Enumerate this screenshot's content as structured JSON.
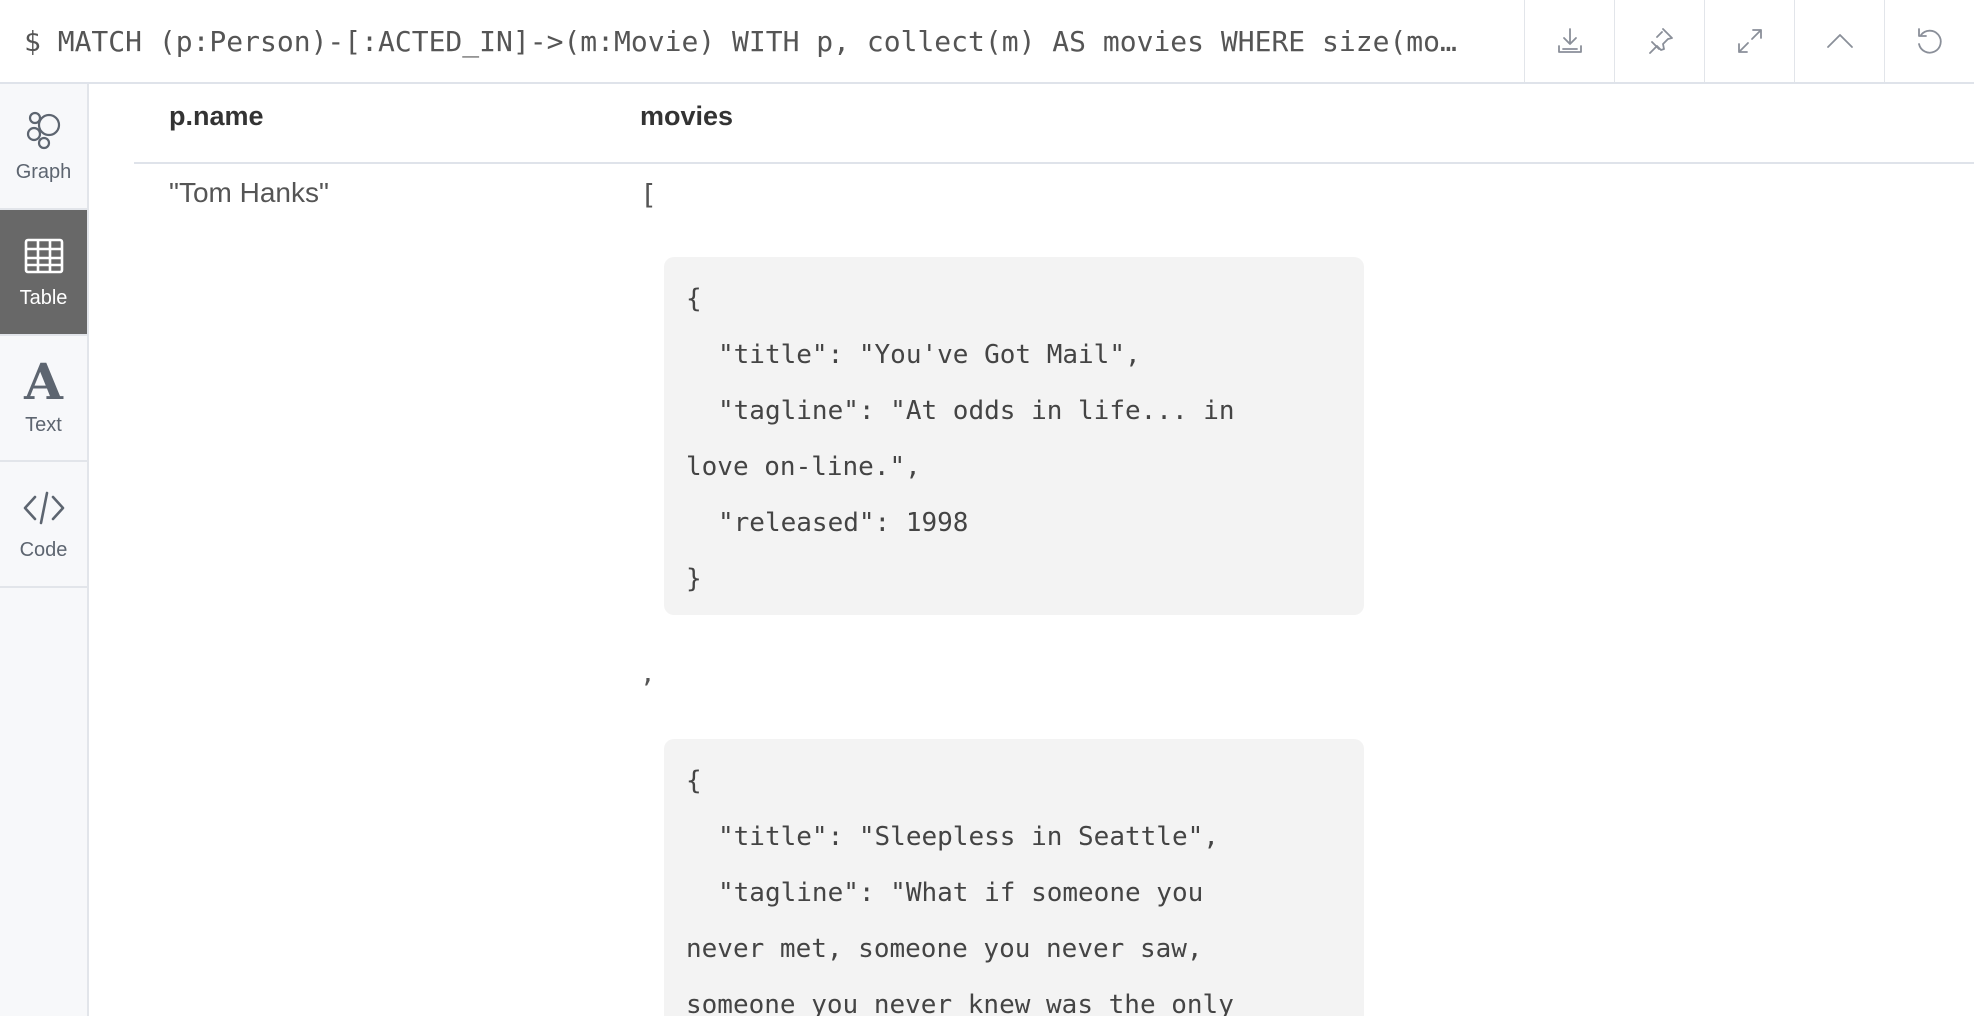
{
  "query": "$ MATCH (p:Person)-[:ACTED_IN]->(m:Movie) WITH p, collect(m) AS movies WHERE size(mo…",
  "toolbar": {
    "download_icon": "download-icon",
    "pin_icon": "pin-icon",
    "expand_icon": "expand-icon",
    "collapse_icon": "chevron-up-icon",
    "refresh_icon": "refresh-icon"
  },
  "sidebar": {
    "items": [
      {
        "label": "Graph",
        "icon": "graph-icon"
      },
      {
        "label": "Table",
        "icon": "table-icon",
        "active": true
      },
      {
        "label": "Text",
        "icon": "text-icon",
        "glyph": "A"
      },
      {
        "label": "Code",
        "icon": "code-icon"
      }
    ]
  },
  "table": {
    "columns": [
      "p.name",
      "movies"
    ],
    "rows": [
      {
        "name": "\"Tom Hanks\"",
        "open_bracket": "[",
        "separator": ",",
        "movies": [
          {
            "open": "{",
            "title_line": "\"title\": \"You've Got Mail\",",
            "tagline_line1": "\"tagline\": \"At odds in life... in",
            "tagline_line2": "love on-line.\",",
            "released_line": "\"released\": 1998",
            "close": "}"
          },
          {
            "open": "{",
            "title_line": "\"title\": \"Sleepless in Seattle\",",
            "tagline_line1": "\"tagline\": \"What if someone you",
            "tagline_line2": "never met, someone you never saw,",
            "tagline_line3": "someone you never knew was the only"
          }
        ]
      }
    ]
  }
}
